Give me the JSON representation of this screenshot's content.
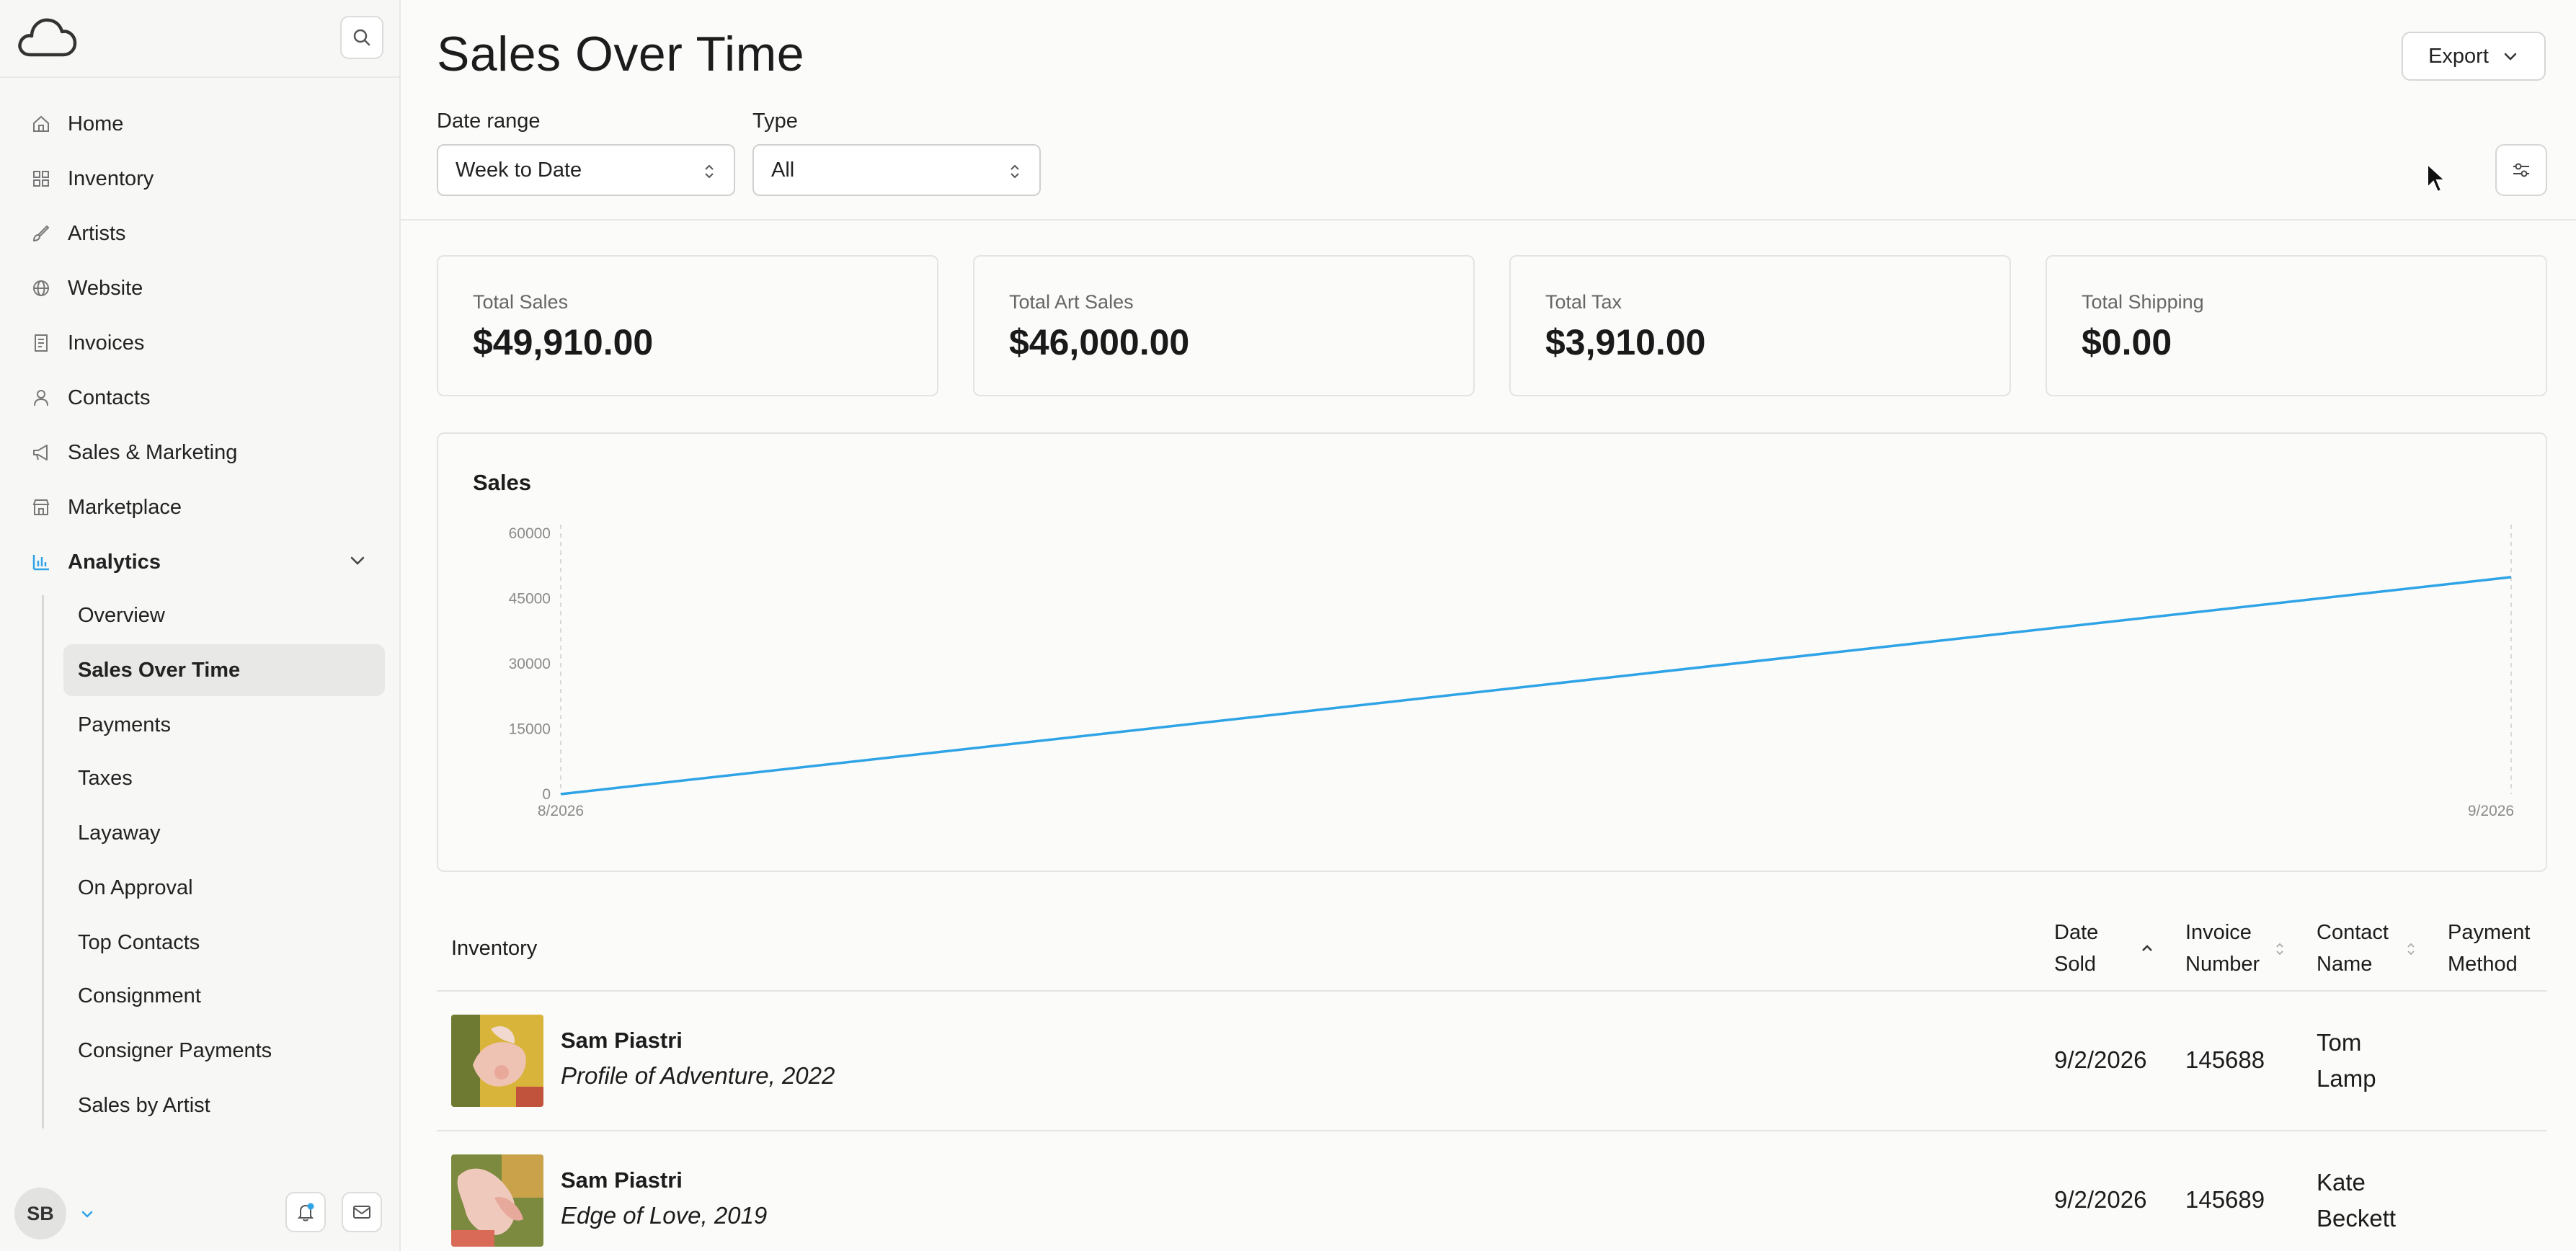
{
  "sidebar": {
    "nav": [
      {
        "label": "Home",
        "icon": "home-icon"
      },
      {
        "label": "Inventory",
        "icon": "grid-icon"
      },
      {
        "label": "Artists",
        "icon": "brush-icon"
      },
      {
        "label": "Website",
        "icon": "globe-icon"
      },
      {
        "label": "Invoices",
        "icon": "invoice-icon"
      },
      {
        "label": "Contacts",
        "icon": "user-icon"
      },
      {
        "label": "Sales & Marketing",
        "icon": "megaphone-icon"
      },
      {
        "label": "Marketplace",
        "icon": "store-icon"
      },
      {
        "label": "Analytics",
        "icon": "chart-icon"
      }
    ],
    "subnav": [
      {
        "label": "Overview"
      },
      {
        "label": "Sales Over Time"
      },
      {
        "label": "Payments"
      },
      {
        "label": "Taxes"
      },
      {
        "label": "Layaway"
      },
      {
        "label": "On Approval"
      },
      {
        "label": "Top Contacts"
      },
      {
        "label": "Consignment"
      },
      {
        "label": "Consigner Payments"
      },
      {
        "label": "Sales by Artist"
      }
    ],
    "user_initials": "SB",
    "accent_color": "#2ea3e6"
  },
  "header": {
    "title": "Sales Over Time",
    "export_label": "Export",
    "filters": {
      "date_range_label": "Date range",
      "date_range_value": "Week to Date",
      "type_label": "Type",
      "type_value": "All"
    }
  },
  "stats": [
    {
      "label": "Total Sales",
      "value": "$49,910.00"
    },
    {
      "label": "Total Art Sales",
      "value": "$46,000.00"
    },
    {
      "label": "Total Tax",
      "value": "$3,910.00"
    },
    {
      "label": "Total Shipping",
      "value": "$0.00"
    }
  ],
  "chart_data": {
    "type": "line",
    "title": "Sales",
    "x": [
      "8/2026",
      "9/2026"
    ],
    "series": [
      {
        "values": [
          0,
          49910
        ],
        "color": "#2ea3e6"
      }
    ],
    "yticks": [
      0,
      15000,
      30000,
      45000,
      60000
    ],
    "ylim": [
      0,
      60000
    ],
    "grid": "vertical-dashed"
  },
  "table": {
    "headers": {
      "inventory": "Inventory",
      "date_sold_1": "Date",
      "date_sold_2": "Sold",
      "invoice_1": "Invoice",
      "invoice_2": "Number",
      "contact_1": "Contact",
      "contact_2": "Name",
      "payment_1": "Payment",
      "payment_2": "Method"
    },
    "rows": [
      {
        "artist": "Sam Piastri",
        "work": "Profile of Adventure, 2022",
        "date_sold": "9/2/2026",
        "invoice": "145688",
        "contact_1": "Tom",
        "contact_2": "Lamp",
        "payment": ""
      },
      {
        "artist": "Sam Piastri",
        "work": "Edge of Love, 2019",
        "date_sold": "9/2/2026",
        "invoice": "145689",
        "contact_1": "Kate",
        "contact_2": "Beckett",
        "payment": ""
      }
    ]
  }
}
